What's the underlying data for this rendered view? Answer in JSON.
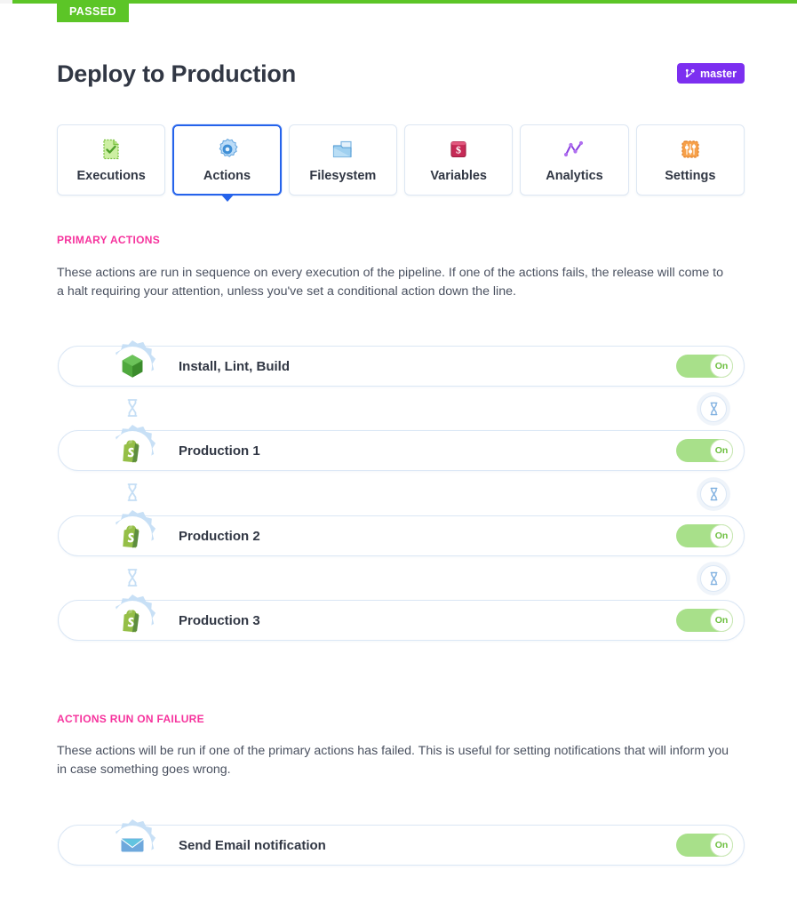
{
  "theme": {
    "accent_green": "#5cc527",
    "accent_pink": "#f6339d",
    "branch_purple": "#7c2ff0",
    "tab_selected_blue": "#2563eb",
    "toggle_green": "#a8e08a"
  },
  "status_badge": {
    "label": "PASSED"
  },
  "header": {
    "title": "Deploy to Production",
    "branch": {
      "label": "master",
      "icon": "branch-icon"
    }
  },
  "tabs": [
    {
      "label": "Executions",
      "icon": "document-check-icon",
      "selected": false
    },
    {
      "label": "Actions",
      "icon": "gear-icon",
      "selected": true
    },
    {
      "label": "Filesystem",
      "icon": "folder-icon",
      "selected": false
    },
    {
      "label": "Variables",
      "icon": "dollar-card-icon",
      "selected": false
    },
    {
      "label": "Analytics",
      "icon": "line-chart-icon",
      "selected": false
    },
    {
      "label": "Settings",
      "icon": "sliders-icon",
      "selected": false
    }
  ],
  "primary_section": {
    "heading": "PRIMARY ACTIONS",
    "description": "These actions are run in sequence on every execution of the pipeline. If one of the actions fails, the release will come to a halt requiring your attention, unless you've set a conditional action down the line.",
    "actions": [
      {
        "label": "Install, Lint, Build",
        "icon": "nodejs-icon",
        "toggle": "On"
      },
      {
        "label": "Production 1",
        "icon": "shopify-icon",
        "toggle": "On"
      },
      {
        "label": "Production 2",
        "icon": "shopify-icon",
        "toggle": "On"
      },
      {
        "label": "Production 3",
        "icon": "shopify-icon",
        "toggle": "On"
      }
    ],
    "connector_icon": "hourglass-icon"
  },
  "failure_section": {
    "heading": "ACTIONS RUN ON FAILURE",
    "description": "These actions will be run if one of the primary actions has failed. This is useful for setting notifications that will inform you in case something goes wrong.",
    "actions": [
      {
        "label": "Send Email notification",
        "icon": "envelope-icon",
        "toggle": "On"
      }
    ]
  }
}
